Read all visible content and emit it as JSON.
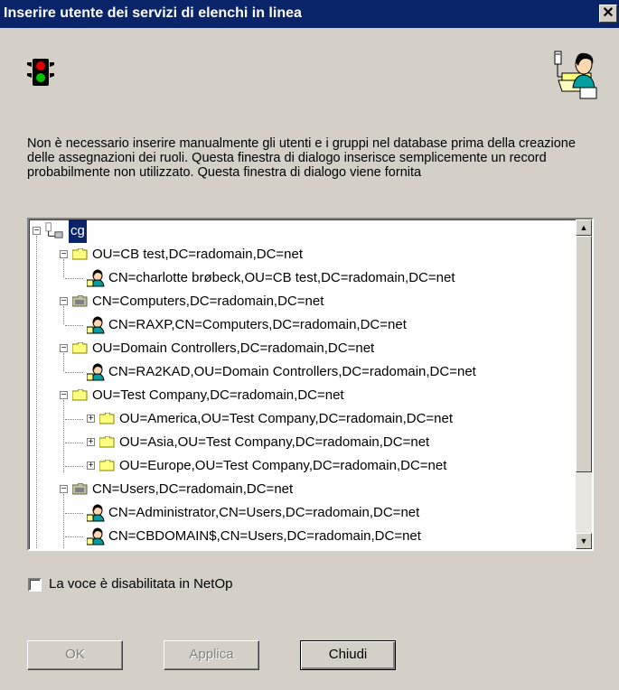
{
  "window": {
    "title": "Inserire utente dei servizi di elenchi in linea",
    "close_glyph": "✕"
  },
  "icons": {
    "left": "traffic-light-icon",
    "right": "user-directory-icon"
  },
  "description": "Non è necessario inserire manualmente gli utenti e i gruppi nel database prima della creazione delle assegnazioni dei ruoli. Questa finestra di dialogo inserisce semplicemente un record probabilmente non utilizzato. Questa finestra di dialogo viene fornita",
  "tree": {
    "root": "cg",
    "nodes": [
      {
        "label": "OU=CB test,DC=radomain,DC=net"
      },
      {
        "label": "CN=charlotte brøbeck,OU=CB test,DC=radomain,DC=net"
      },
      {
        "label": "CN=Computers,DC=radomain,DC=net"
      },
      {
        "label": "CN=RAXP,CN=Computers,DC=radomain,DC=net"
      },
      {
        "label": "OU=Domain Controllers,DC=radomain,DC=net"
      },
      {
        "label": "CN=RA2KAD,OU=Domain Controllers,DC=radomain,DC=net"
      },
      {
        "label": "OU=Test Company,DC=radomain,DC=net"
      },
      {
        "label": "OU=America,OU=Test Company,DC=radomain,DC=net"
      },
      {
        "label": "OU=Asia,OU=Test Company,DC=radomain,DC=net"
      },
      {
        "label": "OU=Europe,OU=Test Company,DC=radomain,DC=net"
      },
      {
        "label": "CN=Users,DC=radomain,DC=net"
      },
      {
        "label": "CN=Administrator,CN=Users,DC=radomain,DC=net"
      },
      {
        "label": "CN=CBDOMAIN$,CN=Users,DC=radomain,DC=net"
      }
    ]
  },
  "checkbox": {
    "label": "La voce è disabilitata in NetOp",
    "checked": false
  },
  "buttons": {
    "ok": "OK",
    "apply": "Applica",
    "close": "Chiudi"
  }
}
